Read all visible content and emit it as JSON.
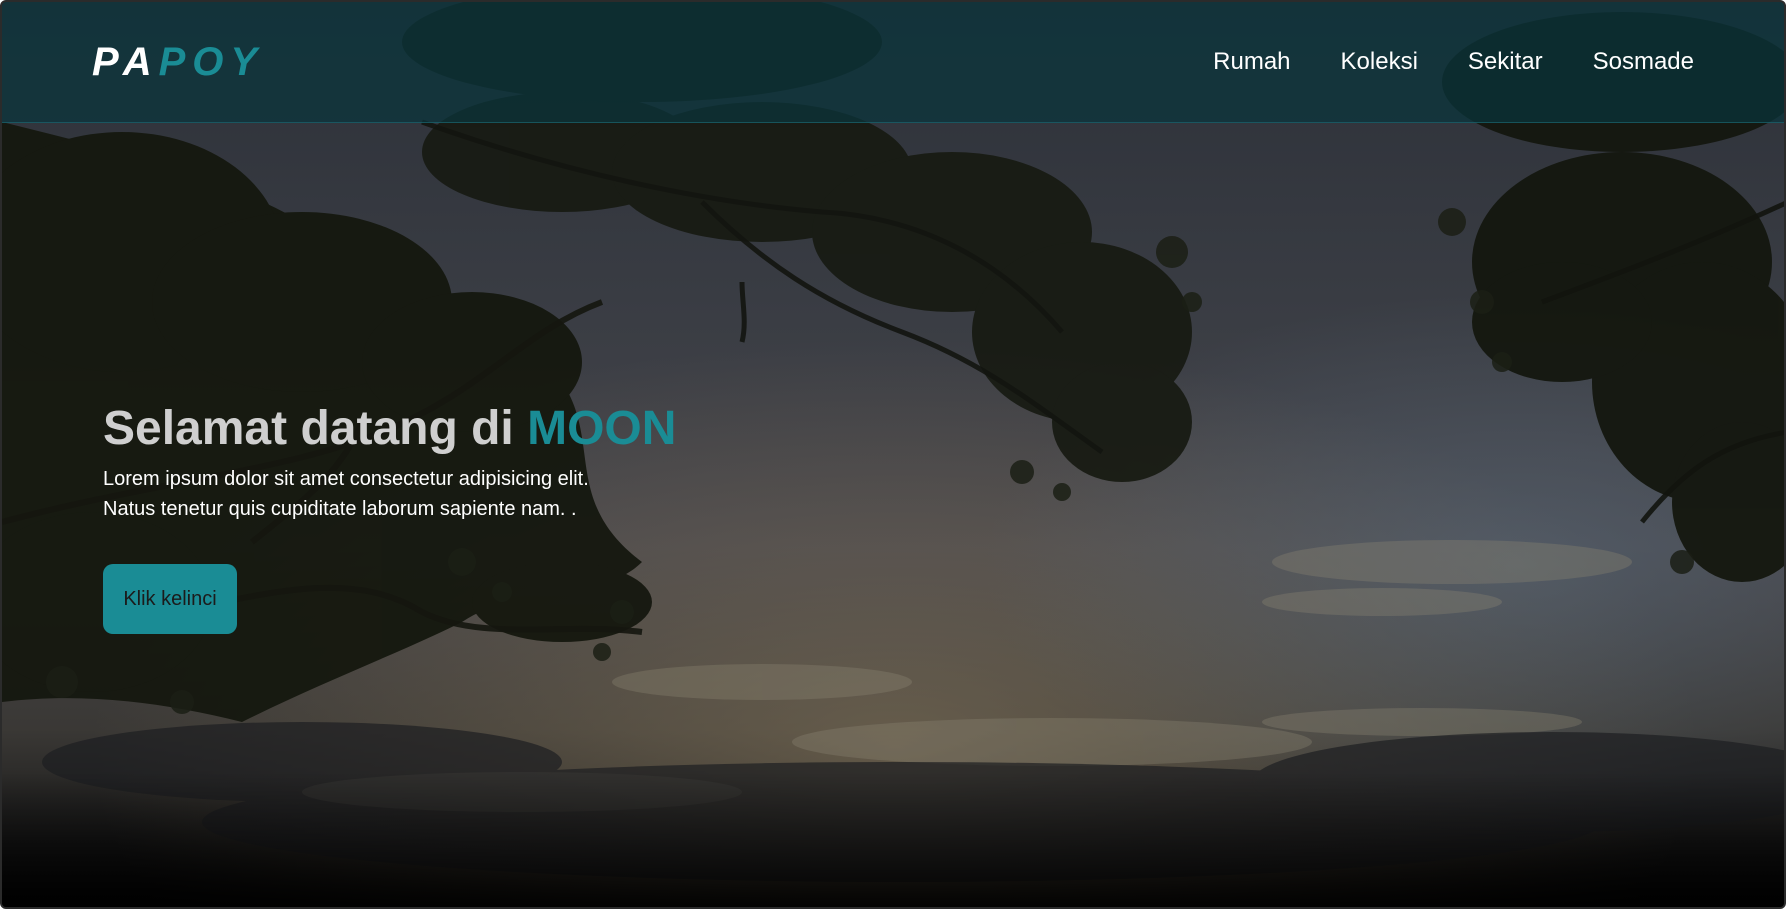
{
  "brand": {
    "logo_part1": "PA",
    "logo_part2": "POY"
  },
  "nav": {
    "items": [
      {
        "label": "Rumah"
      },
      {
        "label": "Koleksi"
      },
      {
        "label": "Sekitar"
      },
      {
        "label": "Sosmade"
      }
    ]
  },
  "hero": {
    "title_prefix": "Selamat datang di ",
    "title_highlight": "MOON",
    "line1": "Lorem ipsum dolor sit amet consectetur adipisicing elit.",
    "line2": "Natus tenetur quis cupiditate laborum sapiente nam. .",
    "button_label": "Klik kelinci",
    "background": "night-sky-with-tree-branches"
  },
  "colors": {
    "accent": "#1a8c95",
    "navbar": "#0a343c",
    "title_text": "#cfcfcf",
    "body_text": "#ffffff"
  }
}
